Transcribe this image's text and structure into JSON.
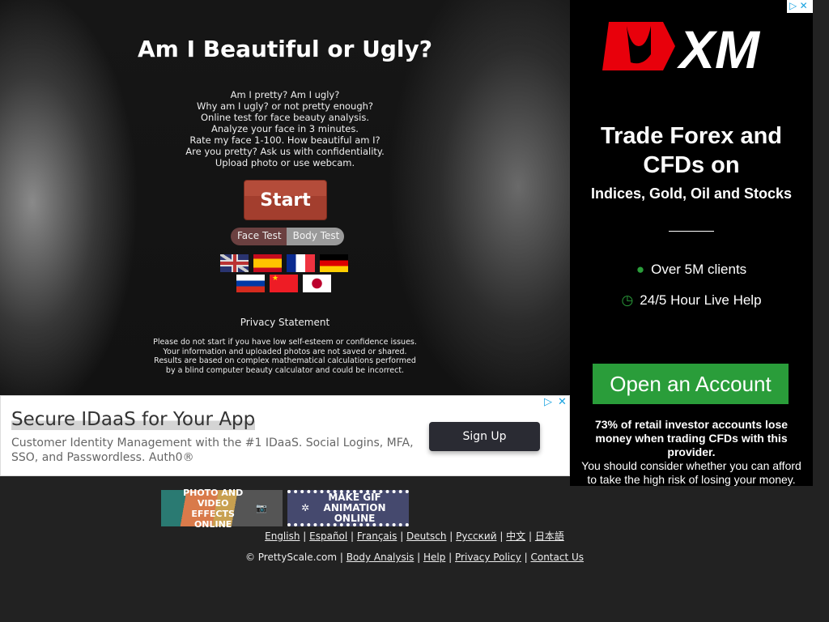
{
  "hero": {
    "title": "Am I Beautiful or Ugly?",
    "intro": [
      "Am I pretty? Am I ugly?",
      "Why am I ugly? or not pretty enough?",
      "Online test for face beauty analysis.",
      "Analyze your face in 3 minutes.",
      "Rate my face 1-100. How beautiful am I?",
      "Are you pretty? Ask us with confidentiality.",
      "Upload photo or use webcam."
    ],
    "start": "Start",
    "face_test": "Face Test",
    "body_test": "Body Test",
    "privacy": "Privacy Statement",
    "warning": [
      "Please do not start if you have low self-esteem or confidence issues.",
      "Your information and uploaded photos are not saved or shared.",
      "Results are based on complex mathematical calculations performed",
      "by a blind computer beauty calculator and could be incorrect."
    ]
  },
  "flags": [
    "uk-flag",
    "spain-flag",
    "france-flag",
    "germany-flag",
    "russia-flag",
    "china-flag",
    "japan-flag"
  ],
  "ad_banner": {
    "headline": "Secure IDaaS for Your App",
    "body": "Customer Identity Management with the #1 IDaaS. Social Logins, MFA, SSO, and Passwordless. Auth0®",
    "button": "Sign Up"
  },
  "ad_side": {
    "logo": "XM",
    "headline": "Trade Forex and CFDs on",
    "sub": "Indices, Gold, Oil and Stocks",
    "f1": "Over 5M clients",
    "f2": "24/5 Hour Live Help",
    "cta": "Open an Account",
    "risk_bold": "73% of retail investor accounts lose money when trading CFDs with this provider.",
    "risk": "You should consider whether you can afford to take the high risk of losing your money.",
    "accent": "#2a9d3a"
  },
  "promos": {
    "p1": "PHOTO AND VIDEO EFFECTS ONLINE",
    "p2": "MAKE GIF ANIMATION ONLINE"
  },
  "languages": [
    "English",
    "Español",
    "Français",
    "Deutsch",
    "Русский",
    "中文",
    "日本語"
  ],
  "footer": {
    "copyright": "© PrettyScale.com",
    "links": [
      "Body Analysis",
      "Help",
      "Privacy Policy",
      "Contact Us"
    ]
  }
}
